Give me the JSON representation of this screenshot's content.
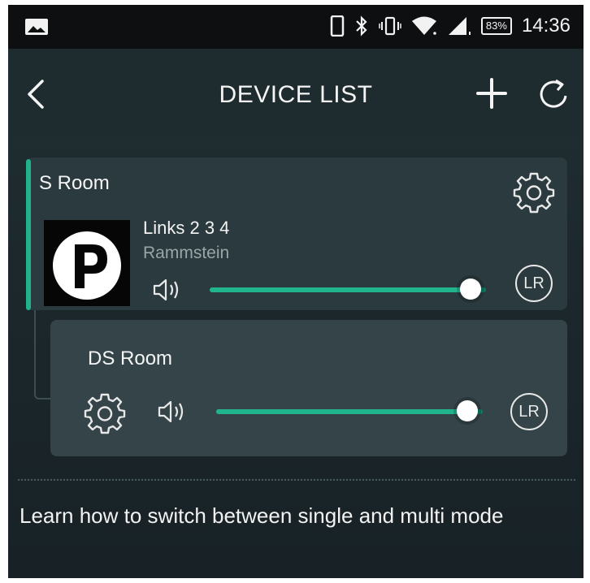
{
  "status_bar": {
    "time": "14:36",
    "battery": "83%",
    "icons": [
      "image-icon",
      "phone-icon",
      "bluetooth-icon",
      "vibrate-icon",
      "wifi-icon",
      "signal-icon"
    ]
  },
  "header": {
    "title": "DEVICE LIST",
    "icons": [
      "back-arrow-icon",
      "plus-icon",
      "refresh-icon"
    ]
  },
  "devices": [
    {
      "room": "S Room",
      "track": "Links 2 3 4",
      "artist": "Rammstein",
      "album_art_letter": "P",
      "volume": 0.98,
      "channel": "LR"
    },
    {
      "room": "DS Room",
      "volume": 0.98,
      "channel": "LR"
    }
  ],
  "footer": {
    "help_text": "Learn how to switch between single and multi mode"
  },
  "colors": {
    "accent": "#21b18b",
    "header_bg": "#1e2b2f",
    "card_bg": "#2a3a3f",
    "card2_bg": "#344449"
  }
}
